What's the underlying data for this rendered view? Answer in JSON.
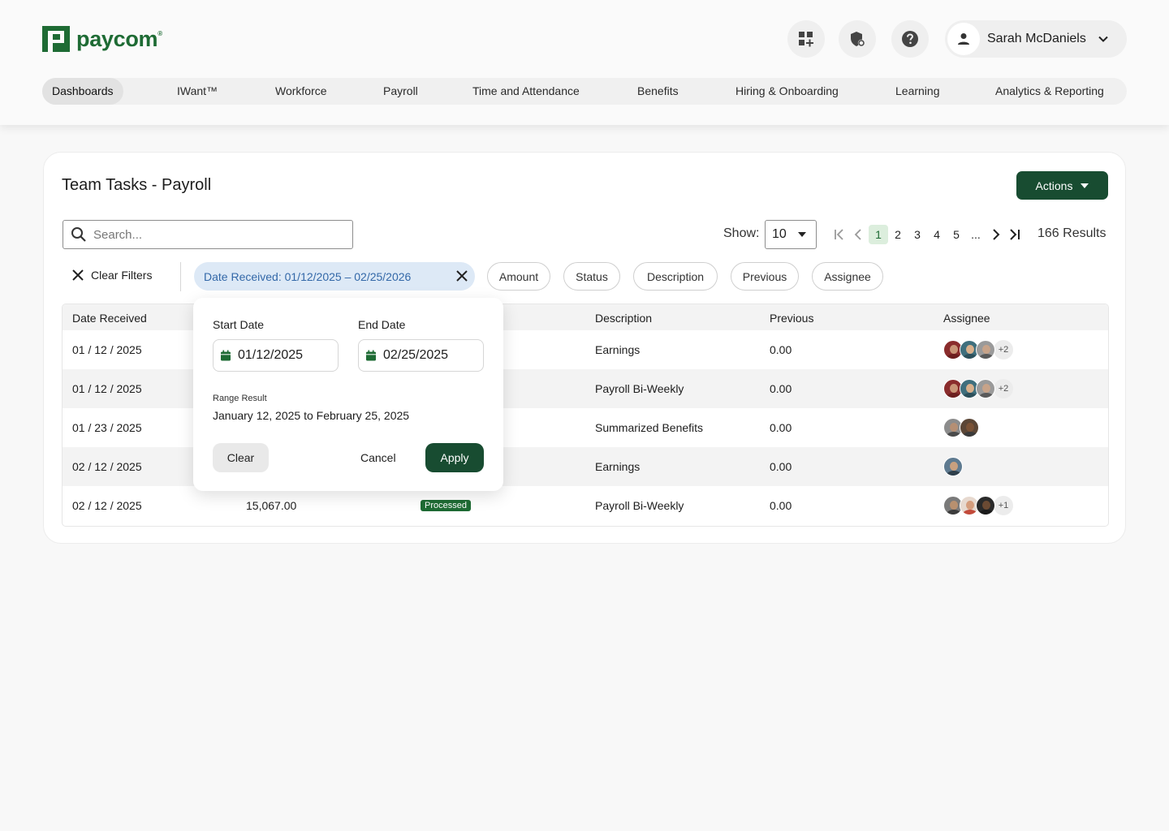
{
  "brand": {
    "name": "paycom",
    "mark": "®"
  },
  "header": {
    "icons": [
      "apps-add-icon",
      "shield-icon",
      "help-icon"
    ],
    "user": {
      "name": "Sarah McDaniels"
    }
  },
  "nav": {
    "items": [
      {
        "label": "Dashboards",
        "active": true
      },
      {
        "label": "IWant™"
      },
      {
        "label": "Workforce"
      },
      {
        "label": "Payroll"
      },
      {
        "label": "Time and Attendance"
      },
      {
        "label": "Benefits"
      },
      {
        "label": "Hiring & Onboarding"
      },
      {
        "label": "Learning"
      },
      {
        "label": "Analytics & Reporting"
      }
    ]
  },
  "card": {
    "title": "Team Tasks - Payroll",
    "actions_label": "Actions",
    "search_placeholder": "Search...",
    "show_label": "Show:",
    "show_value": "10",
    "pages": [
      "1",
      "2",
      "3",
      "4",
      "5",
      "..."
    ],
    "current_page": "1",
    "results": "166 Results",
    "clear_filters": "Clear Filters",
    "active_filter": "Date Received: 01/12/2025 – 02/25/2026",
    "filters": [
      "Amount",
      "Status",
      "Description",
      "Previous",
      "Assignee"
    ]
  },
  "table": {
    "columns": [
      "Date Received",
      "Description",
      "Previous",
      "Assignee"
    ],
    "rows": [
      {
        "date": "01 / 12 / 2025",
        "amount": "",
        "status": "",
        "description": "Earnings",
        "previous": "0.00",
        "more": "+2"
      },
      {
        "date": "01 / 12 / 2025",
        "amount": "",
        "status": "",
        "description": "Payroll Bi-Weekly",
        "previous": "0.00",
        "more": "+2"
      },
      {
        "date": "01 / 23 / 2025",
        "amount": "",
        "status": "",
        "description": "Summarized Benefits",
        "previous": "0.00",
        "more": ""
      },
      {
        "date": "02 / 12 / 2025",
        "amount": "",
        "status": "",
        "description": "Earnings",
        "previous": "0.00",
        "more": ""
      },
      {
        "date": "02 / 12 / 2025",
        "amount": "15,067.00",
        "status": "Processed",
        "description": "Payroll Bi-Weekly",
        "previous": "0.00",
        "more": "+1"
      }
    ]
  },
  "popover": {
    "start_label": "Start Date",
    "end_label": "End Date",
    "start_value": "01/12/2025",
    "end_value": "02/25/2025",
    "range_label": "Range Result",
    "range_value": "January 12, 2025 to February 25, 2025",
    "clear": "Clear",
    "cancel": "Cancel",
    "apply": "Apply"
  },
  "colors": {
    "brand_green": "#1e6b34",
    "primary_dark": "#184c31",
    "filter_blue": "#3368a8",
    "filter_bg": "#dde9f6"
  }
}
